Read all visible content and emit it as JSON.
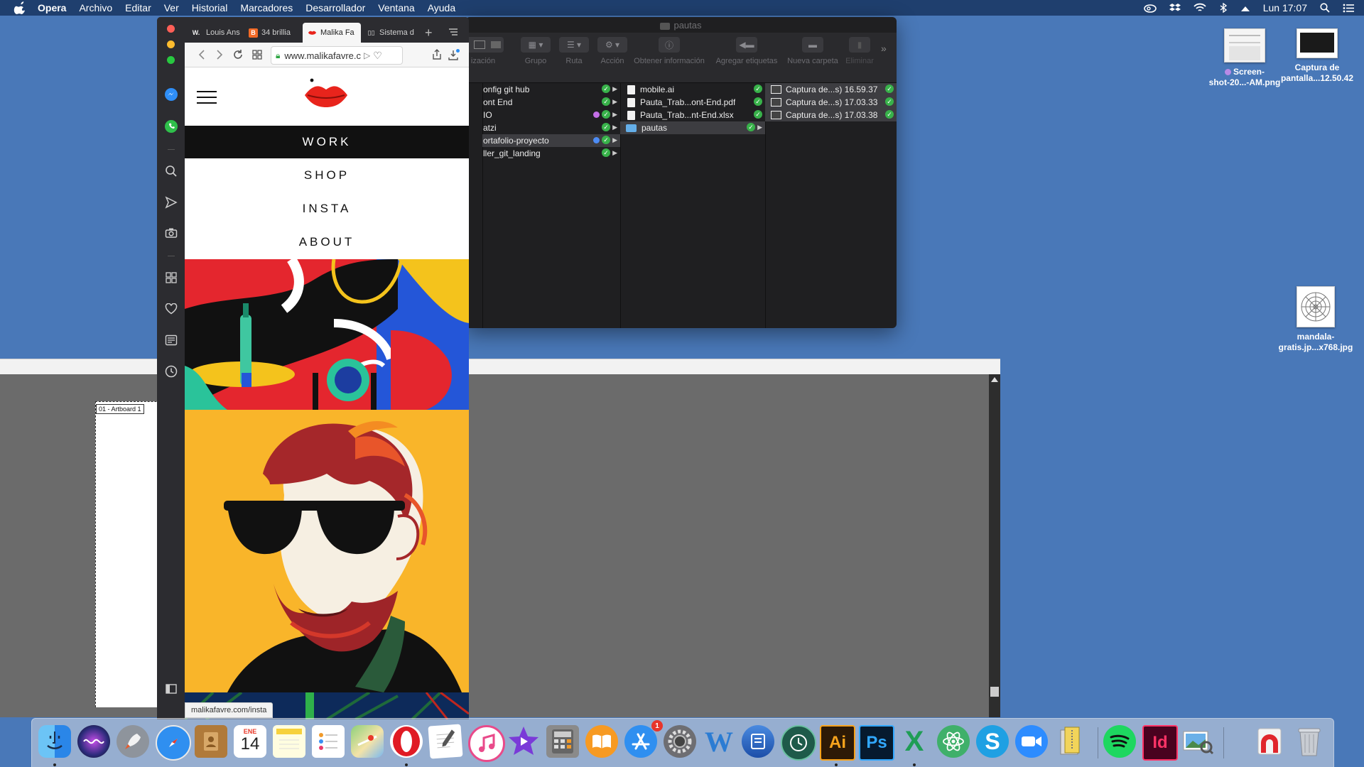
{
  "menubar": {
    "app_name": "Opera",
    "items": [
      "Archivo",
      "Editar",
      "Ver",
      "Historial",
      "Marcadores",
      "Desarrollador",
      "Ventana",
      "Ayuda"
    ],
    "clock": "Lun 17:07"
  },
  "desktop": {
    "icons": [
      {
        "label_line1": "Screen-",
        "label_line2": "shot-20...-AM.png",
        "tag_color": "#b88ae6"
      },
      {
        "label_line1": "Captura de",
        "label_line2": "pantalla...12.50.42"
      },
      {
        "label_line1": "mandala-",
        "label_line2": "gratis.jp...x768.jpg"
      }
    ]
  },
  "illustrator": {
    "artboard_label": "01 - Artboard 1"
  },
  "finder": {
    "title": "pautas",
    "toolbar": [
      {
        "label": "ización"
      },
      {
        "label": "Grupo"
      },
      {
        "label": "Ruta"
      },
      {
        "label": "Acción"
      },
      {
        "label": "Obtener información"
      },
      {
        "label": "Agregar etiquetas"
      },
      {
        "label": "Nueva carpeta"
      },
      {
        "label": "Eliminar"
      }
    ],
    "column1": [
      {
        "name": "onfig git hub",
        "tag": "",
        "folder": true
      },
      {
        "name": "ont End",
        "tag": "",
        "folder": true
      },
      {
        "name": "IO",
        "tag": "#c36ee6",
        "folder": true
      },
      {
        "name": "atzi",
        "tag": "",
        "folder": true
      },
      {
        "name": "ortafolio-proyecto",
        "tag": "#4d8cf5",
        "folder": true,
        "selected": true
      },
      {
        "name": "ller_git_landing",
        "tag": "",
        "folder": true
      }
    ],
    "column2": [
      {
        "name": "mobile.ai",
        "type": "file"
      },
      {
        "name": "Pauta_Trab...ont-End.pdf",
        "type": "file"
      },
      {
        "name": "Pauta_Trab...nt-End.xlsx",
        "type": "file"
      },
      {
        "name": "pautas",
        "type": "folder",
        "selected": true
      }
    ],
    "column3": [
      {
        "name": "Captura de...s) 16.59.37"
      },
      {
        "name": "Captura de...s) 17.03.33"
      },
      {
        "name": "Captura de...s) 17.03.38"
      }
    ]
  },
  "browser": {
    "tabs": [
      {
        "label": "Louis Ans",
        "fav": "W."
      },
      {
        "label": "34 brillia",
        "fav": "B"
      },
      {
        "label": "Malika Fa",
        "fav": "",
        "active": true
      },
      {
        "label": "Sistema d",
        "fav": ""
      }
    ],
    "url": "www.malikafavre.c",
    "status_url": "malikafavre.com/insta",
    "nav": [
      {
        "label": "WORK",
        "active": true
      },
      {
        "label": "SHOP"
      },
      {
        "label": "INSTA"
      },
      {
        "label": "ABOUT"
      }
    ]
  },
  "dock": {
    "calendar_month": "ENE",
    "calendar_day": "14",
    "appstore_badge": "1"
  }
}
